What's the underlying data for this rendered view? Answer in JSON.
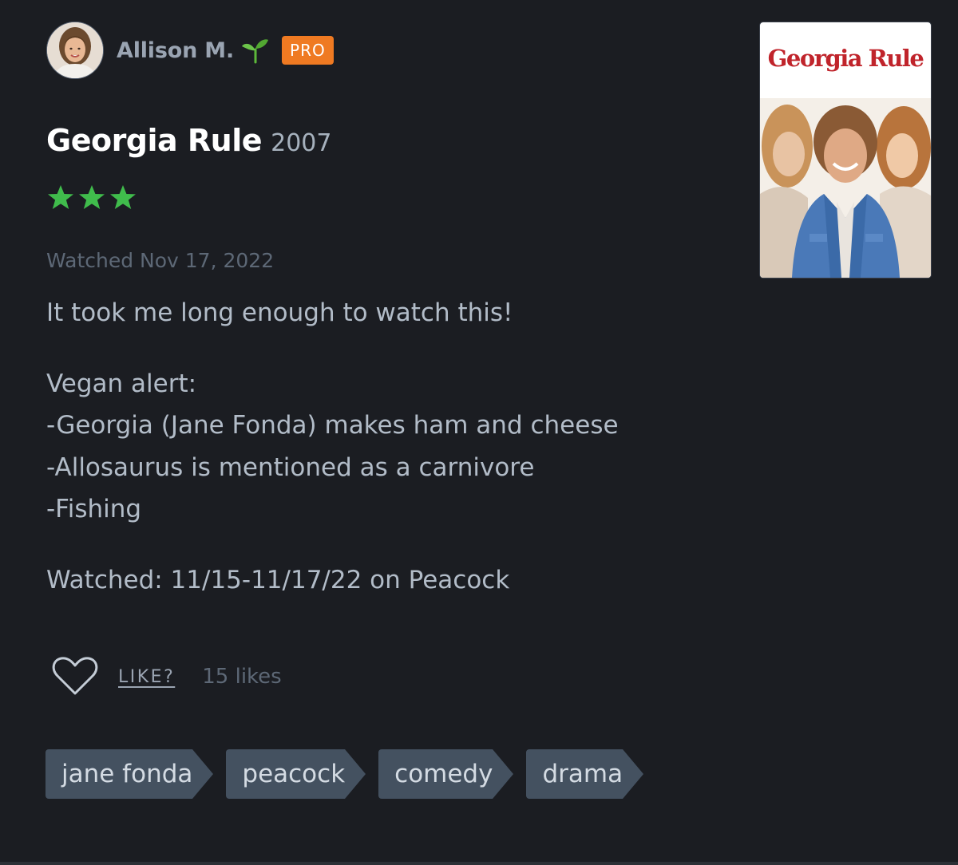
{
  "reviewer": {
    "name": "Allison M.",
    "badge": "PRO",
    "avatar_icon": "user-avatar",
    "status_icon": "sprout-icon"
  },
  "film": {
    "title": "Georgia Rule",
    "year": "2007",
    "poster_title": "Georgia Rule"
  },
  "rating": {
    "stars": 3,
    "max_stars": 5,
    "color": "#40bc4c"
  },
  "watched_date": "Watched Nov 17, 2022",
  "review": {
    "paragraphs": [
      "It took me long enough to watch this!",
      "Vegan alert:\n-Georgia (Jane Fonda) makes ham and cheese\n-Allosaurus is mentioned as a carnivore\n-Fishing",
      "Watched: 11/15-11/17/22 on Peacock"
    ]
  },
  "like": {
    "label": "LIKE?",
    "count": "15 likes",
    "icon": "heart-icon"
  },
  "tags": [
    "jane fonda",
    "peacock",
    "comedy",
    "drama"
  ],
  "colors": {
    "background": "#1b1d22",
    "badge": "#ef7a22",
    "tag_background": "#445160",
    "star": "#40bc4c"
  }
}
